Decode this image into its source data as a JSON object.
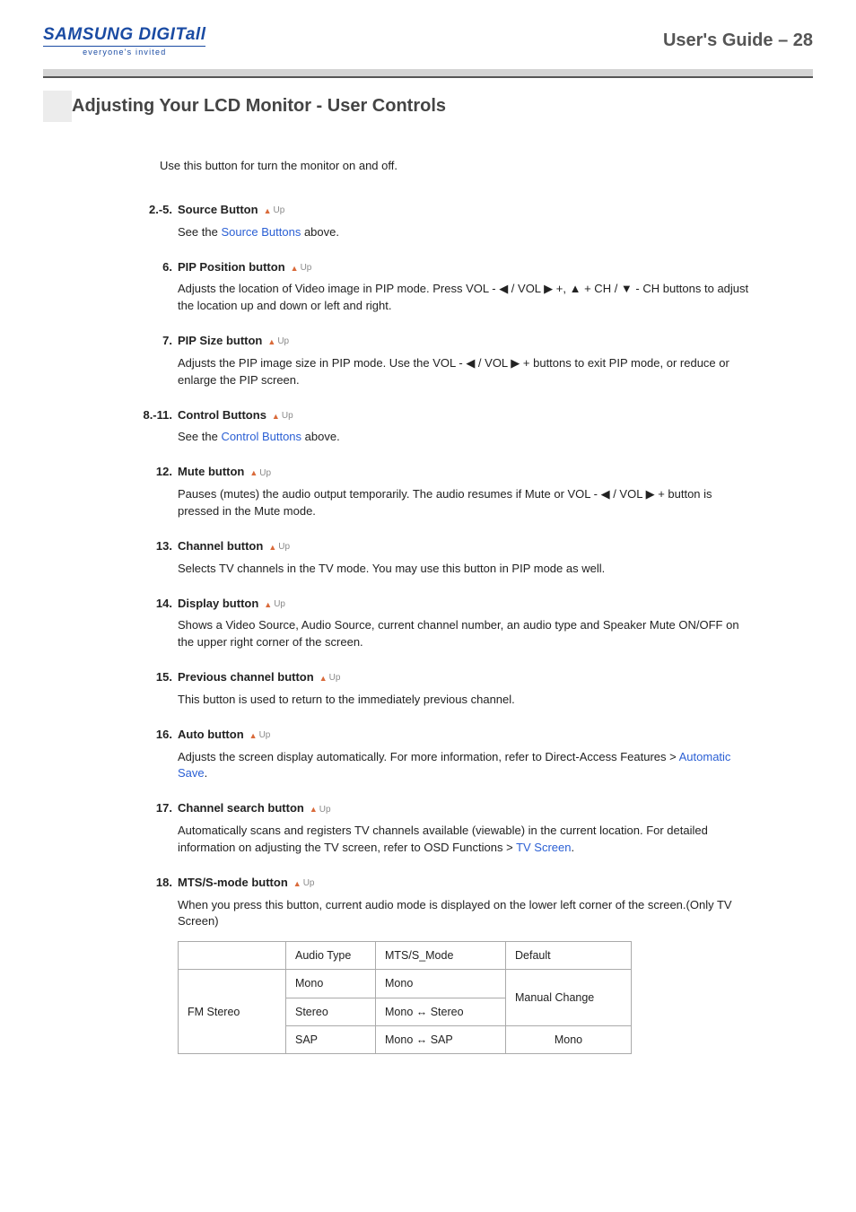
{
  "header": {
    "logo_main": "SAMSUNG DIGITall",
    "logo_tagline": "everyone's invited",
    "page_label": "User's Guide – 28"
  },
  "section_title": "Adjusting Your LCD Monitor - User Controls",
  "intro": "Use this button for turn the monitor on and off.",
  "up_label": "Up",
  "items": {
    "i2_5": {
      "num": "2.-5.",
      "title": "Source Button",
      "pre": "See the ",
      "link": "Source Buttons",
      "post": " above."
    },
    "i6": {
      "num": "6.",
      "title": "PIP Position button",
      "body_a": "Adjusts the location of Video image in PIP mode. Press VOL - ",
      "body_b": " / VOL ",
      "body_c": " +, ",
      "body_d": " + CH / ",
      "body_e": " - CH buttons to adjust the location up and down or left and right."
    },
    "i7": {
      "num": "7.",
      "title": "PIP Size button",
      "body_a": "Adjusts the PIP image size in PIP mode. Use the VOL - ",
      "body_b": " / VOL ",
      "body_c": " + buttons to exit PIP mode, or reduce or enlarge the PIP screen."
    },
    "i8_11": {
      "num": "8.-11.",
      "title": "Control Buttons",
      "pre": "See the ",
      "link": "Control Buttons",
      "post": " above."
    },
    "i12": {
      "num": "12.",
      "title": "Mute button",
      "body_a": "Pauses (mutes) the audio output temporarily. The audio resumes if Mute or VOL - ",
      "body_b": " / VOL ",
      "body_c": " + button is pressed in the Mute mode."
    },
    "i13": {
      "num": "13.",
      "title": "Channel button",
      "body": "Selects TV channels in the TV mode. You may use this button in PIP mode as well."
    },
    "i14": {
      "num": "14.",
      "title": "Display button",
      "body": "Shows a Video Source, Audio Source, current channel number, an audio type and Speaker Mute ON/OFF on the upper right corner of the screen."
    },
    "i15": {
      "num": "15.",
      "title": "Previous channel button",
      "body": "This button is used to return to the immediately previous channel."
    },
    "i16": {
      "num": "16.",
      "title": "Auto button",
      "pre": "Adjusts the screen display automatically. For more information, refer to Direct-Access Features > ",
      "link": "Automatic Save",
      "post": "."
    },
    "i17": {
      "num": "17.",
      "title": "Channel search button",
      "pre": "Automatically scans and registers TV channels available (viewable) in the current location. For detailed information on adjusting the TV screen, refer to OSD Functions > ",
      "link": "TV Screen",
      "post": "."
    },
    "i18": {
      "num": "18.",
      "title": "MTS/S-mode button",
      "body": "When you press this button, current audio mode is displayed on the lower left corner of the screen.(Only TV Screen)"
    }
  },
  "table": {
    "h1": "Audio Type",
    "h2": "MTS/S_Mode",
    "h3": "Default",
    "rowlabel": "FM Stereo",
    "r1c1": "Mono",
    "r1c2": "Mono",
    "r2c1": "Stereo",
    "r2c2a": "Mono  ",
    "r2c2b": "  Stereo",
    "r3c1": "SAP",
    "r3c2a": "Mono  ",
    "r3c2b": "  SAP",
    "d1": "Manual Change",
    "d2": "Mono"
  },
  "glyphs": {
    "left": "◀",
    "right": "▶",
    "up": "▲",
    "down": "▼",
    "bidir": "↔"
  }
}
